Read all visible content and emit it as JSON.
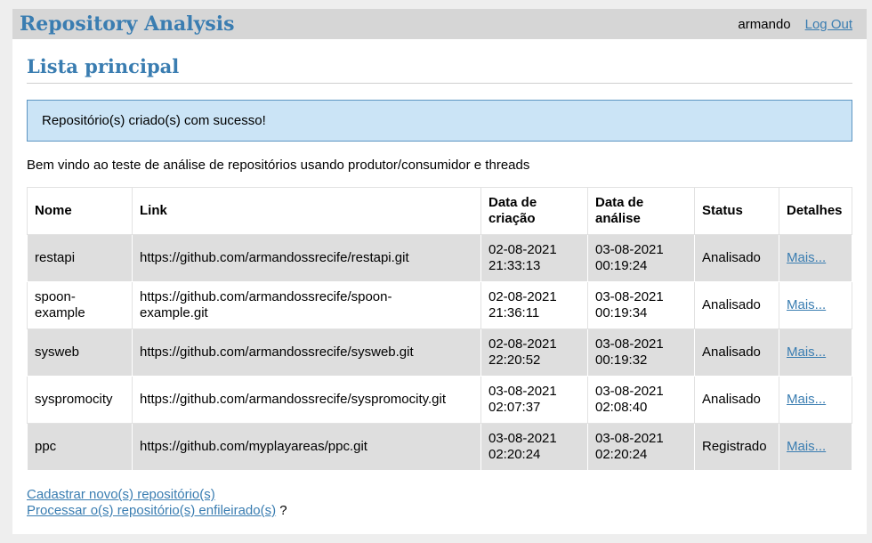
{
  "header": {
    "app_title": "Repository Analysis",
    "username": "armando",
    "logout_label": "Log Out"
  },
  "page": {
    "title": "Lista principal",
    "alert": "Repositório(s) criado(s) com sucesso!",
    "welcome": "Bem vindo ao teste de análise de repositórios usando produtor/consumidor e threads"
  },
  "table": {
    "headers": {
      "nome": "Nome",
      "link": "Link",
      "data_criacao_1": "Data de",
      "data_criacao_2": "criação",
      "data_analise_1": "Data de",
      "data_analise_2": "análise",
      "status": "Status",
      "detalhes": "Detalhes"
    },
    "rows": [
      {
        "nome": "restapi",
        "link": "https://github.com/armandossrecife/restapi.git",
        "criacao_data": "02-08-2021",
        "criacao_hora": "21:33:13",
        "analise_data": "03-08-2021",
        "analise_hora": "00:19:24",
        "status": "Analisado",
        "detalhes": "Mais..."
      },
      {
        "nome_1": "spoon-",
        "nome_2": "example",
        "link_1": "https://github.com/armandossrecife/spoon-",
        "link_2": "example.git",
        "criacao_data": "02-08-2021",
        "criacao_hora": "21:36:11",
        "analise_data": "03-08-2021",
        "analise_hora": "00:19:34",
        "status": "Analisado",
        "detalhes": "Mais..."
      },
      {
        "nome": "sysweb",
        "link": "https://github.com/armandossrecife/sysweb.git",
        "criacao_data": "02-08-2021",
        "criacao_hora": "22:20:52",
        "analise_data": "03-08-2021",
        "analise_hora": "00:19:32",
        "status": "Analisado",
        "detalhes": "Mais..."
      },
      {
        "nome": "syspromocity",
        "link": "https://github.com/armandossrecife/syspromocity.git",
        "criacao_data": "03-08-2021",
        "criacao_hora": "02:07:37",
        "analise_data": "03-08-2021",
        "analise_hora": "02:08:40",
        "status": "Analisado",
        "detalhes": "Mais..."
      },
      {
        "nome": "ppc",
        "link": "https://github.com/myplayareas/ppc.git",
        "criacao_data": "03-08-2021",
        "criacao_hora": "02:20:24",
        "analise_data": "03-08-2021",
        "analise_hora": "02:20:24",
        "status": "Registrado",
        "detalhes": "Mais..."
      }
    ]
  },
  "footer": {
    "cadastrar_label": "Cadastrar novo(s) repositório(s)",
    "processar_label": "Processar o(s) repositório(s) enfileirado(s)",
    "question_mark": "?"
  },
  "colors": {
    "accent": "#3a7db1",
    "topbar_bg": "#d6d6d6",
    "alert_bg": "#cbe4f6",
    "alert_border": "#5d95c2",
    "row_shade": "#dedede"
  }
}
